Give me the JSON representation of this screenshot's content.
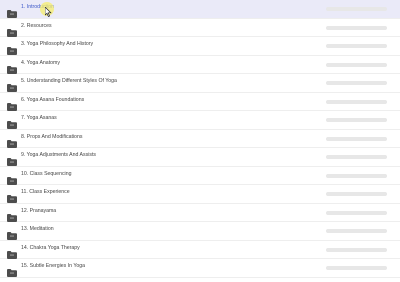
{
  "lessons": [
    {
      "label": "1. Introduction",
      "active": true
    },
    {
      "label": "2. Resources"
    },
    {
      "label": "3. Yoga Philosophy And History"
    },
    {
      "label": "4. Yoga Anatomy"
    },
    {
      "label": "5. Understanding Different Styles Of Yoga"
    },
    {
      "label": "6. Yoga Asana Foundations"
    },
    {
      "label": "7. Yoga Asanas"
    },
    {
      "label": "8. Props And Modifications"
    },
    {
      "label": "9. Yoga Adjustments And Assists"
    },
    {
      "label": "10. Class Sequencing"
    },
    {
      "label": "11. Class Experience"
    },
    {
      "label": "12. Pranayama"
    },
    {
      "label": "13. Meditation"
    },
    {
      "label": "14. Chakra Yoga Therapy"
    },
    {
      "label": "15. Subtle Energies In Yoga"
    }
  ],
  "icons": {
    "row_icon": "folder-icon",
    "pointer": "mouse-cursor-icon"
  },
  "colors": {
    "active_row_bg": "#eaeaf8",
    "active_label": "#3a56c8",
    "folder": "#4d4d4d",
    "placeholder_bar": "#e7e7e7"
  }
}
